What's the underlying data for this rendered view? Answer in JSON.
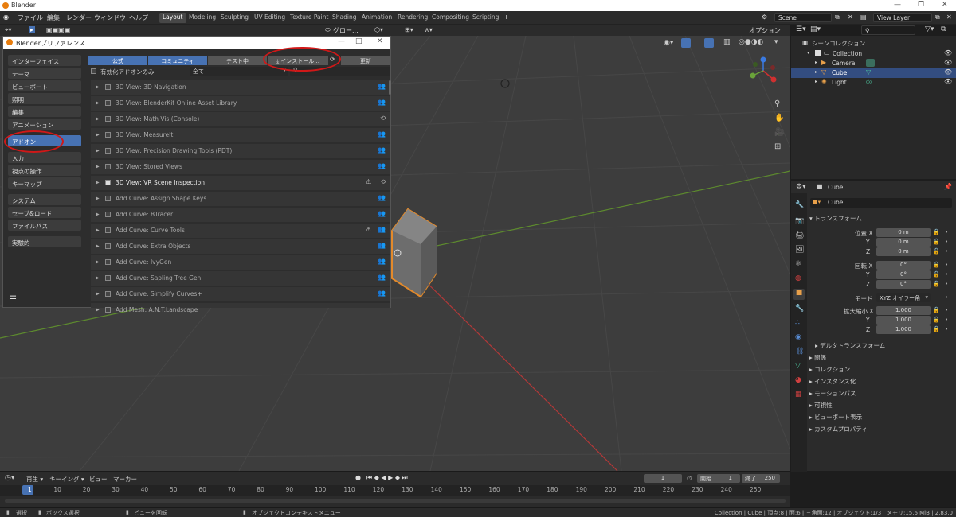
{
  "window": {
    "title": "Blender"
  },
  "menu": [
    "ファイル",
    "編集",
    "レンダー",
    "ウィンドウ",
    "ヘルプ"
  ],
  "workspaces": [
    "Layout",
    "Modeling",
    "Sculpting",
    "UV Editing",
    "Texture Paint",
    "Shading",
    "Animation",
    "Rendering",
    "Compositing",
    "Scripting"
  ],
  "scene": {
    "name": "Scene",
    "view_layer": "View Layer"
  },
  "viewport_header": {
    "transform_orientation": "グロー...",
    "options": "オプション"
  },
  "prefs": {
    "title": "Blenderプリファレンス",
    "sidebar": [
      "インターフェイス",
      "テーマ",
      "ビューポート",
      "照明",
      "編集",
      "アニメーション",
      "アドオン",
      "入力",
      "視点の操作",
      "キーマップ",
      "システム",
      "セーブ&ロード",
      "ファイルパス",
      "実験的"
    ],
    "tabs": [
      "公式",
      "コミュニティ",
      "テスト中",
      "インストール...",
      "更新"
    ],
    "enabled_only": "有効化アドオンのみ",
    "category": "全て",
    "addons": [
      "3D View: 3D Navigation",
      "3D View: BlenderKit Online Asset Library",
      "3D View: Math Vis (Console)",
      "3D View: MeasureIt",
      "3D View: Precision Drawing Tools (PDT)",
      "3D View: Stored Views",
      "3D View: VR Scene Inspection",
      "Add Curve: Assign Shape Keys",
      "Add Curve: BTracer",
      "Add Curve: Curve Tools",
      "Add Curve: Extra Objects",
      "Add Curve: IvyGen",
      "Add Curve: Sapling Tree Gen",
      "Add Curve: Simplify Curves+",
      "Add Mesh: A.N.T.Landscape"
    ]
  },
  "outliner": {
    "root": "シーンコレクション",
    "items": [
      "Collection",
      "Camera",
      "Cube",
      "Light"
    ]
  },
  "properties": {
    "object_name": "Cube",
    "header": "Cube",
    "transform": "トランスフォーム",
    "loc_label": "位置 X",
    "rot_label": "回転 X",
    "scale_label": "拡大縮小 X",
    "y": "Y",
    "z": "Z",
    "loc": [
      "0 m",
      "0 m",
      "0 m"
    ],
    "rot": [
      "0°",
      "0°",
      "0°"
    ],
    "mode_label": "モード",
    "mode": "XYZ オイラー角",
    "scale": [
      "1.000",
      "1.000",
      "1.000"
    ],
    "sections": [
      "デルタトランスフォーム",
      "関係",
      "コレクション",
      "インスタンス化",
      "モーションパス",
      "可視性",
      "ビューポート表示",
      "カスタムプロパティ"
    ]
  },
  "timeline": {
    "menus": [
      "再生",
      "キーイング",
      "ビュー",
      "マーカー"
    ],
    "current": "1",
    "start_label": "開始",
    "start": "1",
    "end_label": "終了",
    "end": "250",
    "ticks": [
      "1",
      "10",
      "20",
      "30",
      "40",
      "50",
      "60",
      "70",
      "80",
      "90",
      "100",
      "110",
      "120",
      "130",
      "140",
      "150",
      "160",
      "170",
      "180",
      "190",
      "200",
      "210",
      "220",
      "230",
      "240",
      "250"
    ]
  },
  "status": {
    "select": "選択",
    "box_select": "ボックス選択",
    "rotate_view": "ビューを回転",
    "context_menu": "オブジェクトコンテキストメニュー",
    "info": "Collection | Cube | 頂点:8 | 面:6 | 三角面:12 | オブジェクト:1/3 | メモリ:15.6 MiB | 2.83.0"
  }
}
